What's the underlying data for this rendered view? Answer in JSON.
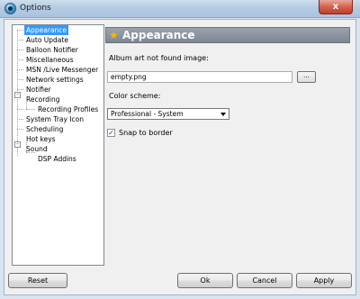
{
  "window": {
    "title": "Options",
    "close_label": "x",
    "icon": "app-globe-icon"
  },
  "tree": {
    "items": [
      {
        "label": "Appearance",
        "selected": true
      },
      {
        "label": "Auto Update"
      },
      {
        "label": "Balloon Notifier"
      },
      {
        "label": "Miscellaneous"
      },
      {
        "label": "MSN /Live Messenger"
      },
      {
        "label": "Network settings"
      },
      {
        "label": "Notifier"
      },
      {
        "label": "Recording",
        "expander": "-"
      },
      {
        "label": "Recording Profiles"
      },
      {
        "label": "System Tray Icon"
      },
      {
        "label": "Scheduling"
      },
      {
        "label": "Hot keys"
      },
      {
        "label": "Sound",
        "expander": "-"
      },
      {
        "label": "DSP Addins"
      }
    ]
  },
  "page": {
    "header_title": "Appearance",
    "header_icon": "star-icon",
    "album_art_label": "Album art not found image:",
    "album_art_value": "empty.png",
    "browse_label": "...",
    "color_scheme_label": "Color scheme:",
    "color_scheme_value": "Professional - System",
    "snap_label": "Snap to border",
    "snap_checked": true
  },
  "buttons": {
    "reset": "Reset",
    "ok": "Ok",
    "cancel": "Cancel",
    "apply": "Apply"
  }
}
